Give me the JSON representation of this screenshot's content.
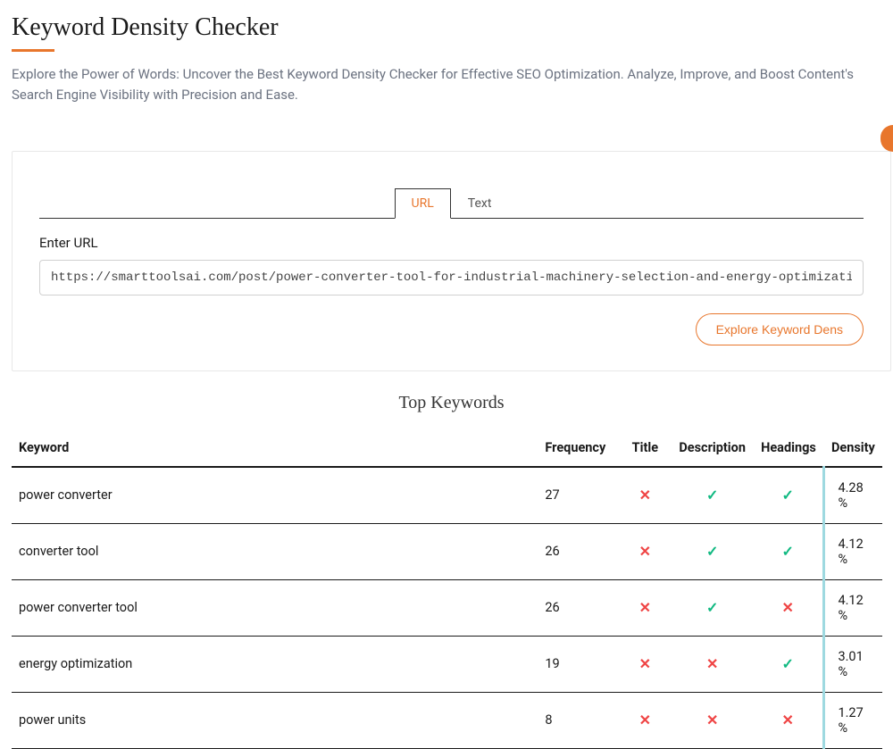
{
  "page": {
    "title": "Keyword Density Checker",
    "subtitle": "Explore the Power of Words: Uncover the Best Keyword Density Checker for Effective SEO Optimization. Analyze, Improve, and Boost Content's Search Engine Visibility with Precision and Ease."
  },
  "tabs": {
    "url": "URL",
    "text": "Text"
  },
  "form": {
    "label": "Enter URL",
    "value": "https://smarttoolsai.com/post/power-converter-tool-for-industrial-machinery-selection-and-energy-optimization",
    "button": "Explore Keyword Dens"
  },
  "results": {
    "title": "Top Keywords",
    "headers": {
      "keyword": "Keyword",
      "frequency": "Frequency",
      "title": "Title",
      "description": "Description",
      "headings": "Headings",
      "density": "Density"
    },
    "rows": [
      {
        "keyword": "power converter",
        "frequency": "27",
        "title": false,
        "description": true,
        "headings": true,
        "density": "4.28 %"
      },
      {
        "keyword": "converter tool",
        "frequency": "26",
        "title": false,
        "description": true,
        "headings": true,
        "density": "4.12 %"
      },
      {
        "keyword": "power converter tool",
        "frequency": "26",
        "title": false,
        "description": true,
        "headings": false,
        "density": "4.12 %"
      },
      {
        "keyword": "energy optimization",
        "frequency": "19",
        "title": false,
        "description": false,
        "headings": true,
        "density": "3.01 %"
      },
      {
        "keyword": "power units",
        "frequency": "8",
        "title": false,
        "description": false,
        "headings": false,
        "density": "1.27 %"
      }
    ]
  }
}
